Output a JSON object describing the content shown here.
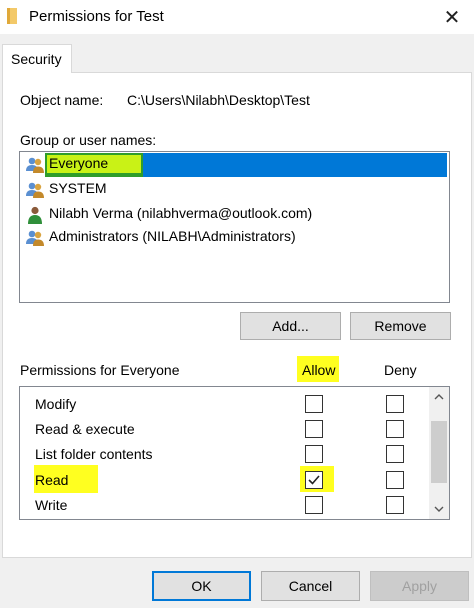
{
  "window": {
    "title": "Permissions for Test",
    "close_glyph": "✕"
  },
  "tabs": [
    {
      "label": "Security"
    }
  ],
  "object": {
    "label": "Object name:",
    "value": "C:\\Users\\Nilabh\\Desktop\\Test"
  },
  "group_label": "Group or user names:",
  "users": [
    {
      "name": "Everyone",
      "icon": "users-group-icon",
      "selected": true
    },
    {
      "name": "SYSTEM",
      "icon": "users-group-icon",
      "selected": false
    },
    {
      "name": "Nilabh Verma (nilabhverma@outlook.com)",
      "icon": "user-icon",
      "selected": false
    },
    {
      "name": "Administrators (NILABH\\Administrators)",
      "icon": "users-group-icon",
      "selected": false
    }
  ],
  "buttons": {
    "add": "Add...",
    "remove": "Remove",
    "ok": "OK",
    "cancel": "Cancel",
    "apply": "Apply"
  },
  "permissions": {
    "header": "Permissions for Everyone",
    "allow_label": "Allow",
    "deny_label": "Deny",
    "rows": [
      {
        "name": "Modify",
        "allow": false,
        "deny": false
      },
      {
        "name": "Read & execute",
        "allow": false,
        "deny": false
      },
      {
        "name": "List folder contents",
        "allow": false,
        "deny": false
      },
      {
        "name": "Read",
        "allow": true,
        "deny": false
      },
      {
        "name": "Write",
        "allow": false,
        "deny": false
      }
    ]
  },
  "colors": {
    "selection": "#0078d7",
    "highlight_yellow": "#ffff20",
    "highlight_green": "#c9f216"
  }
}
